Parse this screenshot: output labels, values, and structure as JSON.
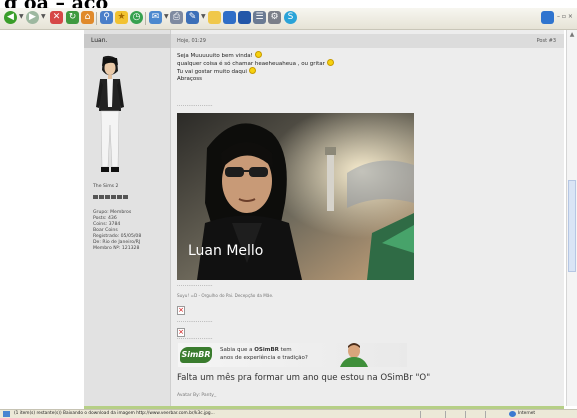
{
  "page": {
    "title_fragment": "g ôa – ąçõ"
  },
  "toolbar": {
    "icons": [
      "back-icon",
      "forward-icon",
      "stop-icon",
      "refresh-icon",
      "home-icon",
      "search-icon",
      "favorites-icon",
      "history-icon",
      "mail-icon",
      "print-icon",
      "edit-icon",
      "folder-icon",
      "window-icon",
      "window-icon",
      "messenger-icon",
      "research-icon",
      "skype-icon"
    ],
    "accent": "#2f6ec7"
  },
  "user": {
    "name": "Luan.",
    "game": "The Sims 2",
    "group": "Grupo: Membros",
    "posts": "Posts: 436",
    "coins": "Coins: 3784",
    "boar_coins": "Boar Coins",
    "registered": "Registrado: 05/05/08",
    "from": "De: Rio de Janeiro/RJ",
    "member_no": "Membro Nº: 121328"
  },
  "post": {
    "time": "Hoje, 01:29",
    "number": "Post #3",
    "lines": [
      "Seja Muuuuuito bem vinda!",
      "qualquer coisa é só chamar heaeheuaheua , ou gritar",
      "Tu vai gostar muito daqui",
      "Abraçoss"
    ],
    "dots": "...................",
    "image_caption": "Luan Mello",
    "signature": "Suyu! =D - Orgulho do Pai. Decepção da Mãe.",
    "banner": {
      "brand": "SimBR",
      "line1_a": "Sabia que a ",
      "line1_b": "OSimBR",
      "line1_c": " tem",
      "line2": "anos de experiência e tradição?"
    },
    "tagline": "Falta um mês pra formar um ano que estou na OSimBr \"O\"",
    "author": "Avatar By: Panty_"
  },
  "statusbar": {
    "text": "(1 item(s) restante(s)) Baixando o download da imagem http://www.veerbar.com.br/k3c.jpg...",
    "zone": "Internet"
  }
}
